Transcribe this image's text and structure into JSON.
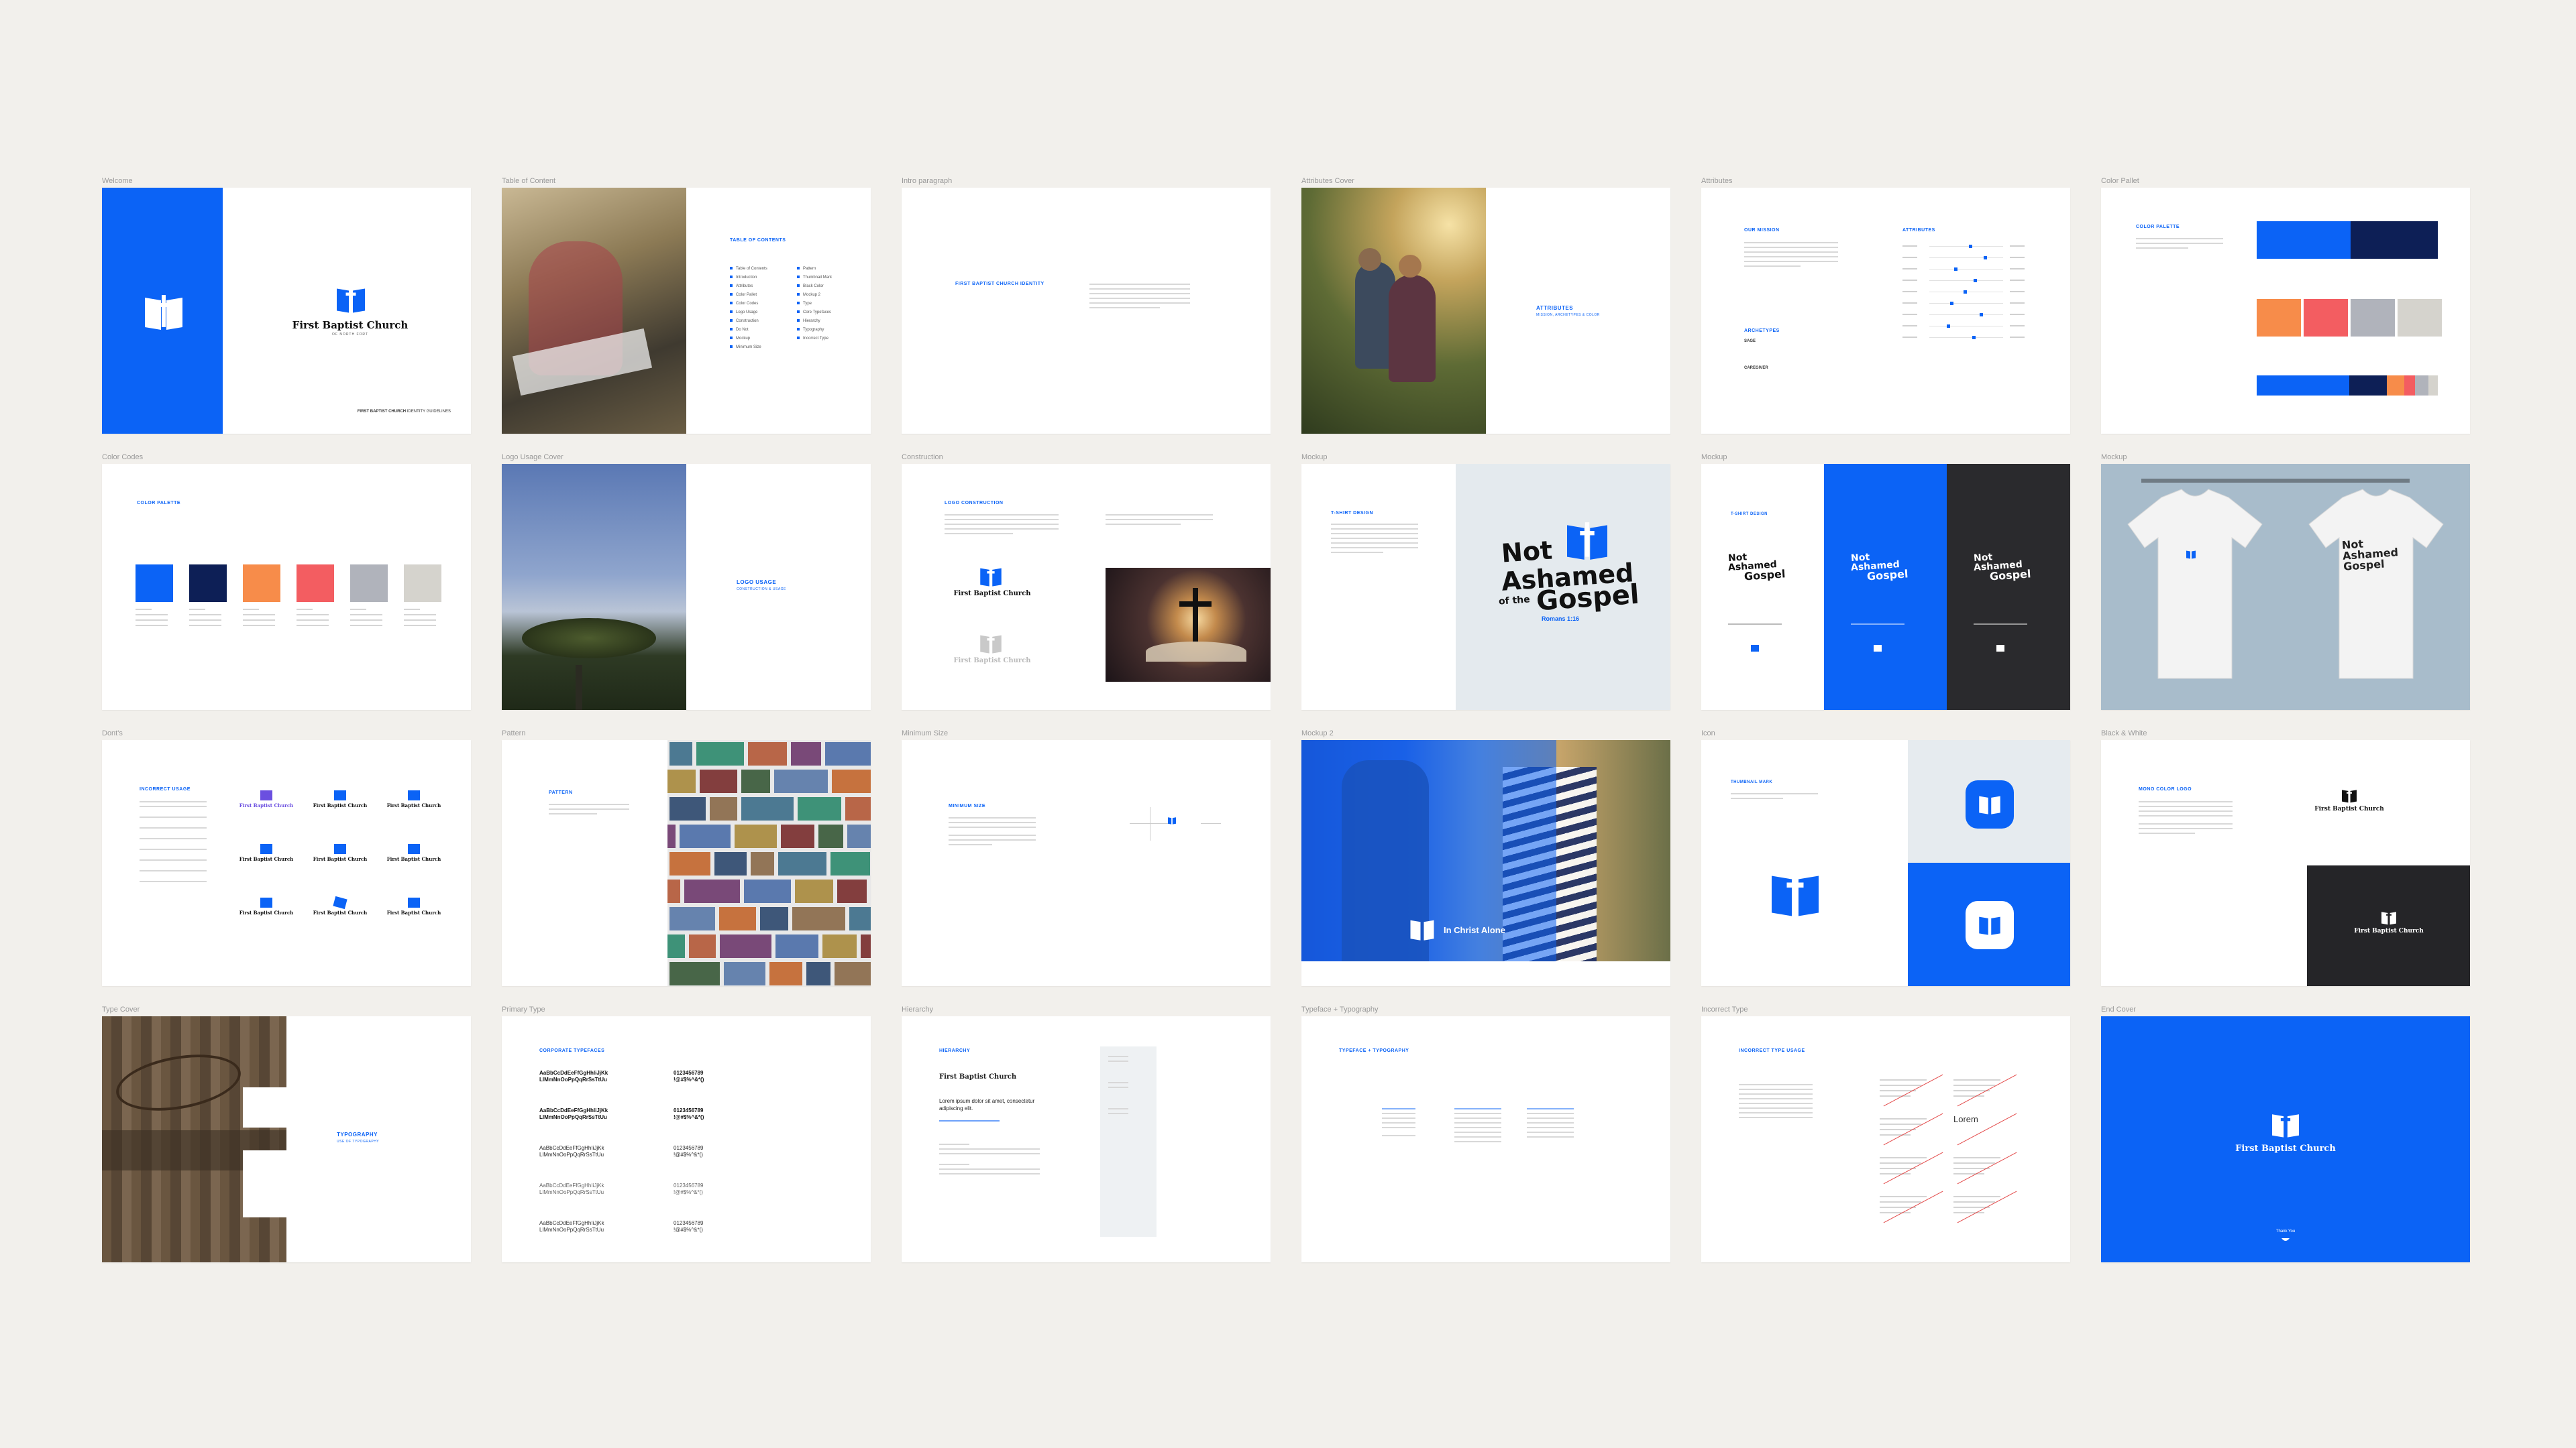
{
  "labels": {
    "welcome": "Welcome",
    "toc": "Table of Content",
    "intro": "Intro paragraph",
    "attributes_cover": "Attributes Cover",
    "attributes": "Attributes",
    "color_pallet": "Color Pallet",
    "color_codes": "Color Codes",
    "logo_usage_cover": "Logo Usage Cover",
    "construction": "Construction",
    "mockup": "Mockup",
    "mockup_b": "Mockup",
    "mockup_c": "Mockup",
    "donts": "Dont's",
    "pattern": "Pattern",
    "minimum_size": "Minimum Size",
    "mockup2": "Mockup 2",
    "icon": "Icon",
    "black_white": "Black & White",
    "type_cover": "Type Cover",
    "primary_type": "Primary Type",
    "hierarchy": "Hierarchy",
    "typeface_typography": "Typeface + Typography",
    "incorrect_type": "Incorrect Type",
    "end_cover": "End Cover"
  },
  "welcome": {
    "logo_name": "First Baptist Church",
    "logo_sub": "OF NORTH FORT",
    "footer_bold": "FIRST BAPTIST CHURCH",
    "footer_rest": "IDENTITY GUIDELINES"
  },
  "toc": {
    "title": "TABLE OF CONTENTS",
    "col1": [
      "Table of Contents",
      "Introduction",
      "Attributes",
      "Color Pallet",
      "Color Codes",
      "Logo Usage",
      "Construction",
      "Do Not",
      "Mockup",
      "Minimum Size"
    ],
    "col2": [
      "Pattern",
      "Thumbnail Mark",
      "Black Color",
      "Mockup 2",
      "Type",
      "Core Typefaces",
      "Hierarchy",
      "Typography",
      "Incorrect Type"
    ]
  },
  "intro": {
    "title": "FIRST BAPTIST CHURCH IDENTITY"
  },
  "attributes_cover": {
    "title": "ATTRIBUTES",
    "sub": "MISSION, ARCHETYPES & COLOR"
  },
  "attributes": {
    "mission": "OUR MISSION",
    "archetypes": "ARCHETYPES",
    "attributes": "ATTRIBUTES",
    "arch1": "SAGE",
    "arch2": "CAREGIVER"
  },
  "color_pallet": {
    "title": "COLOR PALETTE"
  },
  "color_codes": {
    "title": "COLOR PALETTE"
  },
  "logo_usage_cover": {
    "title": "LOGO USAGE",
    "sub": "CONSTRUCTION & USAGE"
  },
  "construction": {
    "title": "LOGO CONSTRUCTION",
    "logo_name": "First Baptist Church"
  },
  "mockup_shirt": {
    "title": "T-SHIRT DESIGN",
    "line1": "Not",
    "line2": "Ashamed",
    "line3a": "of the",
    "line3b": "Gospel",
    "verse": "Romans 1:16"
  },
  "mockup_b": {
    "title": "T-SHIRT DESIGN"
  },
  "donts": {
    "title": "INCORRECT USAGE",
    "logo_name": "First Baptist Church"
  },
  "pattern": {
    "title": "PATTERN"
  },
  "minimum_size": {
    "title": "MINIMUM SIZE"
  },
  "mockup2": {
    "caption": "In Christ Alone"
  },
  "icon": {
    "title": "THUMBNAIL MARK"
  },
  "black_white": {
    "title": "MONO COLOR LOGO",
    "logo_name": "First Baptist Church"
  },
  "type_cover": {
    "title": "TYPOGRAPHY",
    "sub": "USE OF TYPOGRAPHY"
  },
  "primary_type": {
    "title": "CORPORATE TYPEFACES",
    "rows": [
      {
        "a": "AaBbCcDdEeFfGgHhIiJjKk",
        "b": "LlMmNnOoPpQqRrSsTtUu",
        "n": "0123456789",
        "s": "!@#$%^&*()"
      },
      {
        "a": "AaBbCcDdEeFfGgHhIiJjKk",
        "b": "LlMmNnOoPpQqRrSsTtUu",
        "n": "0123456789",
        "s": "!@#$%^&*()"
      },
      {
        "a": "AaBbCcDdEeFfGgHhIiJjKk",
        "b": "LlMmNnOoPpQqRrSsTtUu",
        "n": "0123456789",
        "s": "!@#$%^&*()"
      },
      {
        "a": "AaBbCcDdEeFfGgHhIiJjKk",
        "b": "LlMmNnOoPpQqRrSsTtUu",
        "n": "0123456789",
        "s": "!@#$%^&*()"
      },
      {
        "a": "AaBbCcDdEeFfGgHhIiJjKk",
        "b": "LlMmNnOoPpQqRrSsTtUu",
        "n": "0123456789",
        "s": "!@#$%^&*()"
      }
    ]
  },
  "hierarchy": {
    "title": "HIERARCHY",
    "h1": "First Baptist Church",
    "h2a": "Lorem ipsum dolor sit amet, consectetur",
    "h2b": "adipiscing elit."
  },
  "typeface_typography": {
    "title": "TYPEFACE + TYPOGRAPHY"
  },
  "incorrect_type": {
    "title": "INCORRECT TYPE USAGE",
    "lorem": "Lorem"
  },
  "end_cover": {
    "logo_name": "First Baptist Church",
    "thanks": "Thank You"
  },
  "colors": {
    "blue": "#0b63f6",
    "navy": "#0d1f56",
    "orange": "#f78c4a",
    "coral": "#f35d61",
    "gray": "#b0b3bb",
    "sand": "#d5d3cd"
  }
}
